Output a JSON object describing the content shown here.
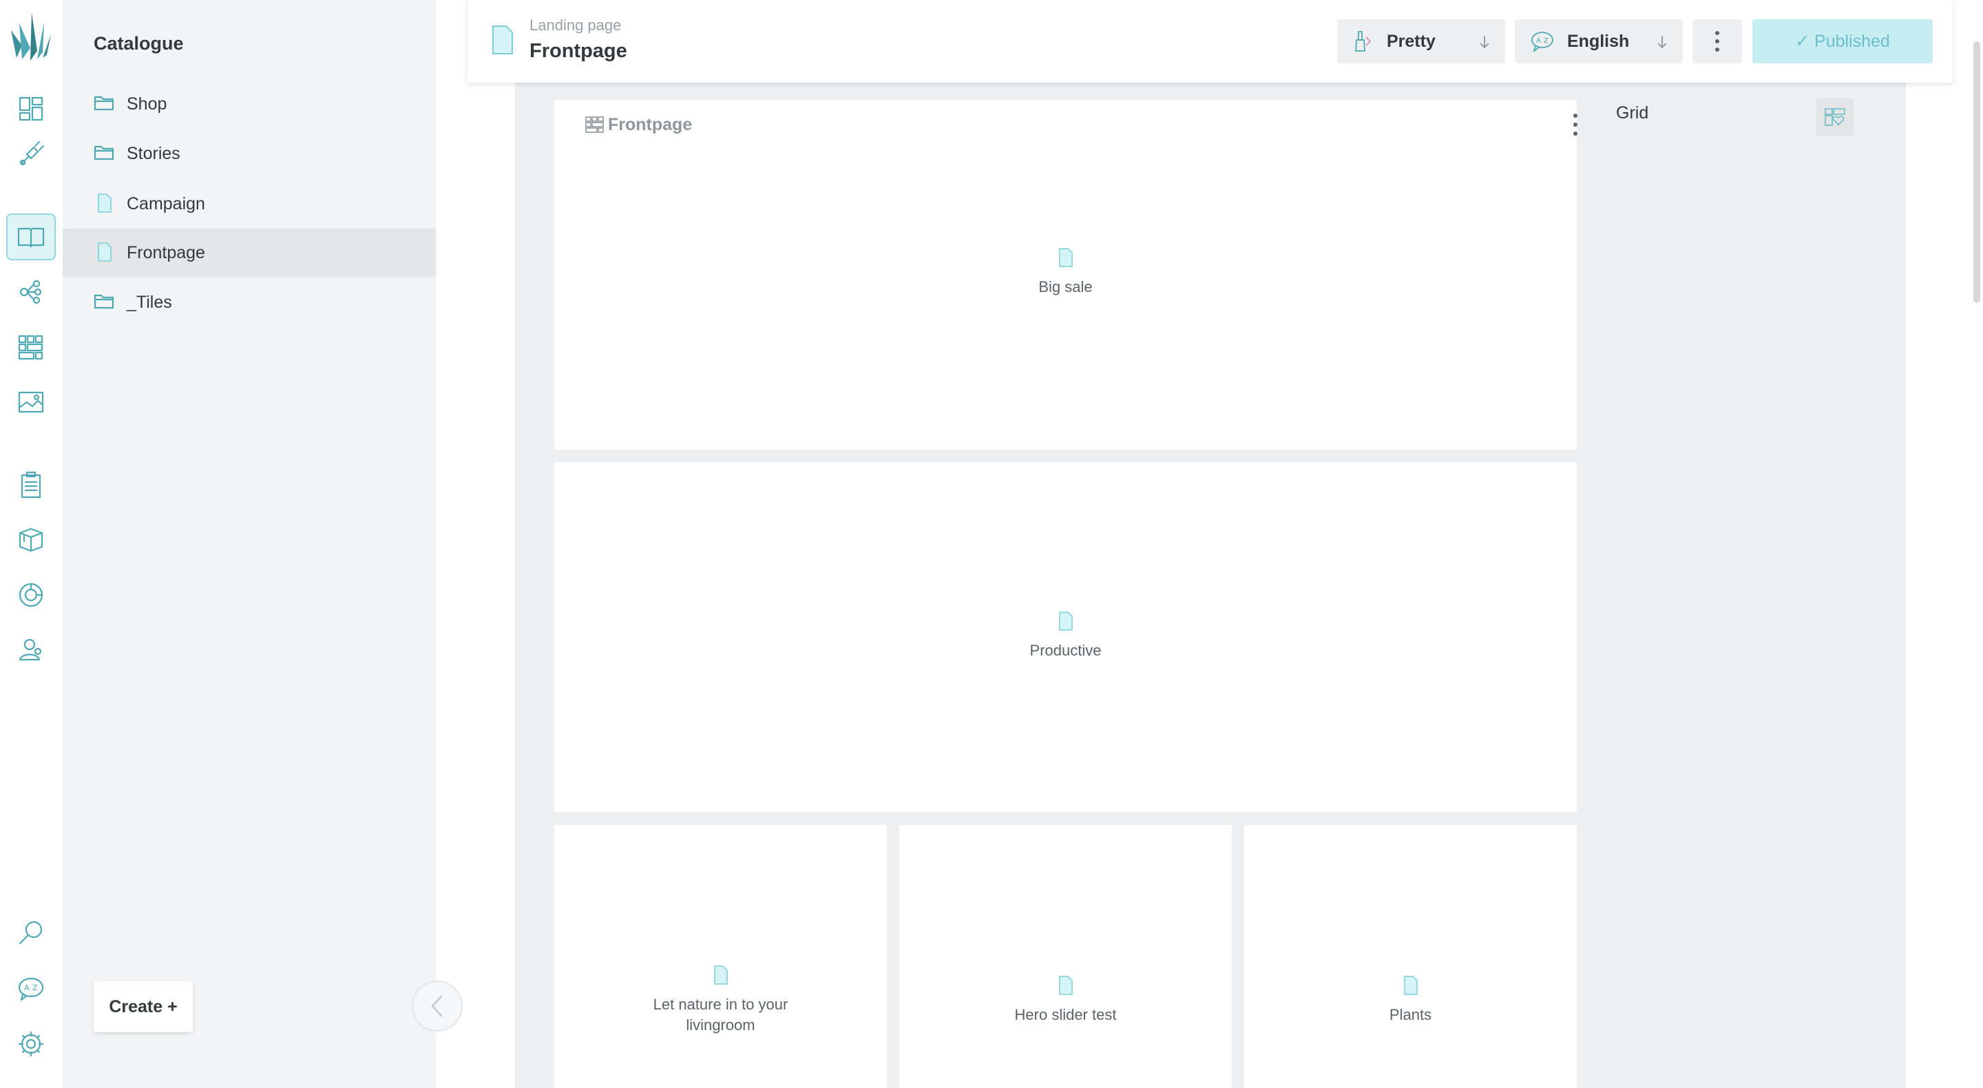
{
  "rail": {
    "items": [
      {
        "name": "dashboard-icon"
      },
      {
        "name": "pen-tool-icon"
      },
      {
        "name": "catalogue-book-icon",
        "active": true
      },
      {
        "name": "relations-icon"
      },
      {
        "name": "tiles-grid-icon"
      },
      {
        "name": "image-icon"
      },
      {
        "name": "clipboard-icon"
      },
      {
        "name": "box-icon"
      },
      {
        "name": "pie-chart-icon"
      },
      {
        "name": "users-icon"
      },
      {
        "name": "search-icon"
      },
      {
        "name": "translate-icon"
      },
      {
        "name": "settings-icon"
      }
    ]
  },
  "tree": {
    "title": "Catalogue",
    "items": [
      {
        "label": "Shop",
        "type": "folder"
      },
      {
        "label": "Stories",
        "type": "folder"
      },
      {
        "label": "Campaign",
        "type": "document"
      },
      {
        "label": "Frontpage",
        "type": "document",
        "selected": true
      },
      {
        "label": "_Tiles",
        "type": "folder"
      }
    ],
    "create_label": "Create +"
  },
  "topbar": {
    "doc_type": "Landing page",
    "doc_title": "Frontpage",
    "pretty_label": "Pretty",
    "language_label": "English",
    "published_label": "✓ Published"
  },
  "canvas": {
    "grid_title": "Frontpage",
    "blocks": [
      {
        "label": "Big sale"
      },
      {
        "label": "Productive"
      },
      {
        "label": "Let nature in to your livingroom"
      },
      {
        "label": "Hero slider test"
      },
      {
        "label": "Plants"
      }
    ]
  },
  "side_panel": {
    "grid_label": "Grid"
  },
  "colors": {
    "accent": "#4fa9b4",
    "published_bg": "#c6edf1",
    "panel_bg": "#f3f4f5"
  }
}
